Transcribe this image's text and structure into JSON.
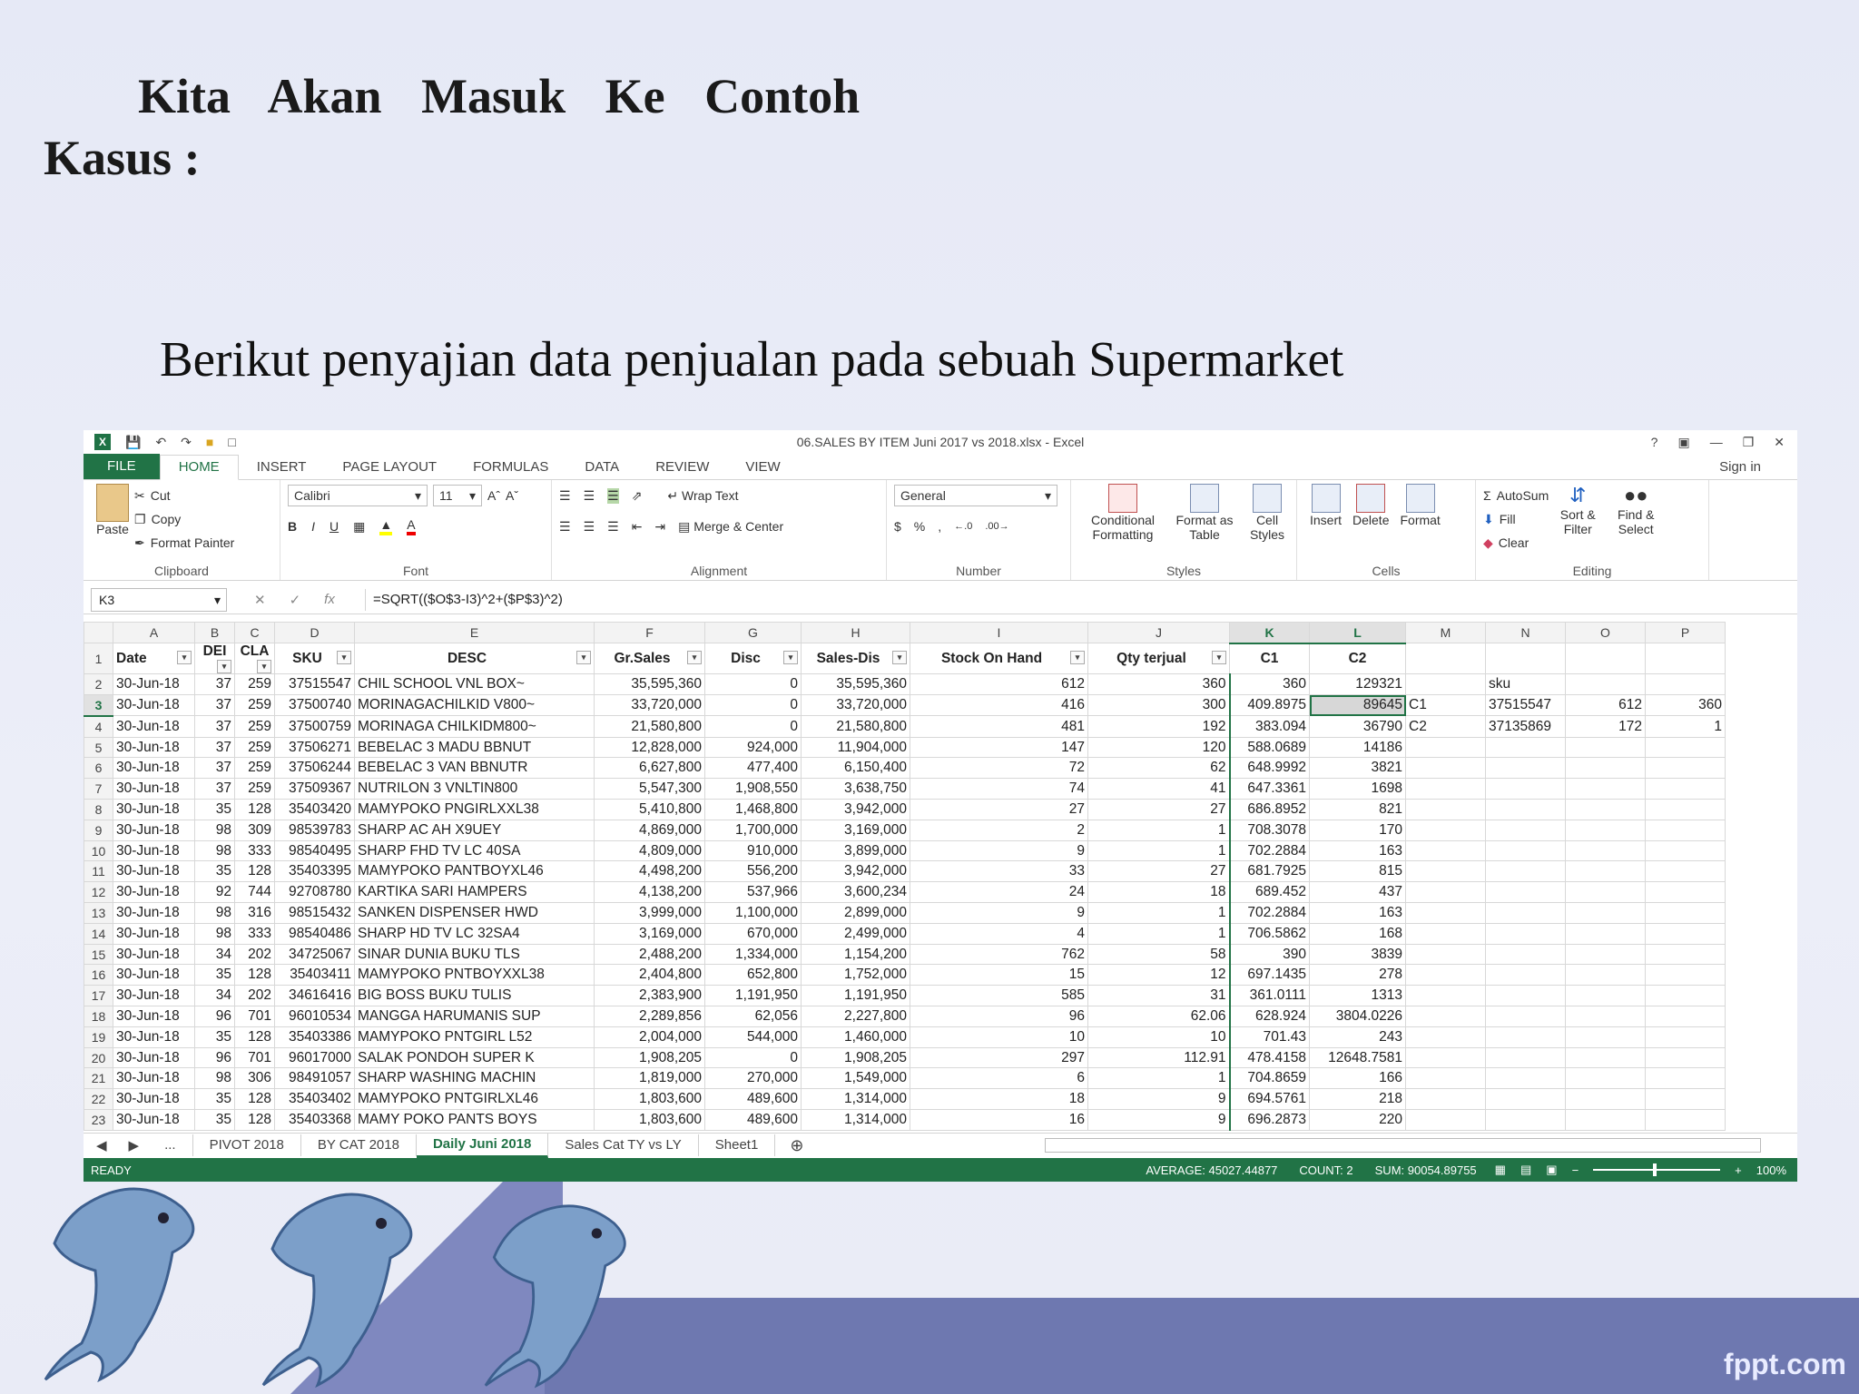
{
  "slide": {
    "title_line1": "Kita Akan Masuk Ke Contoh",
    "title_line2": "Kasus :",
    "subtitle": "Berikut penyajian data penjualan pada sebuah Supermarket",
    "watermark": "fppt.com"
  },
  "excel": {
    "window_title": "06.SALES BY ITEM Juni 2017 vs  2018.xlsx - Excel",
    "sign_in": "Sign in",
    "tabs": [
      "FILE",
      "HOME",
      "INSERT",
      "PAGE LAYOUT",
      "FORMULAS",
      "DATA",
      "REVIEW",
      "VIEW"
    ],
    "ribbon": {
      "clipboard": {
        "paste": "Paste",
        "cut": "Cut",
        "copy": "Copy",
        "format_painter": "Format Painter",
        "label": "Clipboard"
      },
      "font": {
        "name": "Calibri",
        "size": "11",
        "label": "Font"
      },
      "alignment": {
        "wrap": "Wrap Text",
        "merge": "Merge & Center",
        "label": "Alignment"
      },
      "number": {
        "format": "General",
        "label": "Number"
      },
      "styles": {
        "cond": "Conditional Formatting",
        "table": "Format as Table",
        "cell": "Cell Styles",
        "label": "Styles"
      },
      "cells": {
        "insert": "Insert",
        "delete": "Delete",
        "format": "Format",
        "label": "Cells"
      },
      "editing": {
        "autosum": "AutoSum",
        "fill": "Fill",
        "clear": "Clear",
        "sort": "Sort & Filter",
        "find": "Find & Select",
        "label": "Editing"
      }
    },
    "namebox": "K3",
    "formula": "=SQRT(($O$3-I3)^2+($P$3)^2)",
    "columns": [
      "A",
      "B",
      "C",
      "D",
      "E",
      "F",
      "G",
      "H",
      "I",
      "J",
      "K",
      "L",
      "M",
      "N",
      "O",
      "P"
    ],
    "header_row": [
      "Date",
      "DEI",
      "CLA",
      "SKU",
      "DESC",
      "Gr.Sales",
      "Disc",
      "Sales-Dis",
      "Stock On Hand",
      "Qty terjual",
      "C1",
      "C2"
    ],
    "rows": [
      [
        "30-Jun-18",
        "37",
        "259",
        "37515547",
        "CHIL SCHOOL VNL BOX~",
        "35,595,360",
        "0",
        "35,595,360",
        "612",
        "360",
        "360",
        "129321"
      ],
      [
        "30-Jun-18",
        "37",
        "259",
        "37500740",
        "MORINAGACHILKID V800~",
        "33,720,000",
        "0",
        "33,720,000",
        "416",
        "300",
        "409.8975",
        "89645"
      ],
      [
        "30-Jun-18",
        "37",
        "259",
        "37500759",
        "MORINAGA CHILKIDM800~",
        "21,580,800",
        "0",
        "21,580,800",
        "481",
        "192",
        "383.094",
        "36790"
      ],
      [
        "30-Jun-18",
        "37",
        "259",
        "37506271",
        "BEBELAC 3 MADU BBNUT",
        "12,828,000",
        "924,000",
        "11,904,000",
        "147",
        "120",
        "588.0689",
        "14186"
      ],
      [
        "30-Jun-18",
        "37",
        "259",
        "37506244",
        "BEBELAC 3 VAN BBNUTR",
        "6,627,800",
        "477,400",
        "6,150,400",
        "72",
        "62",
        "648.9992",
        "3821"
      ],
      [
        "30-Jun-18",
        "37",
        "259",
        "37509367",
        "NUTRILON 3 VNLTIN800",
        "5,547,300",
        "1,908,550",
        "3,638,750",
        "74",
        "41",
        "647.3361",
        "1698"
      ],
      [
        "30-Jun-18",
        "35",
        "128",
        "35403420",
        "MAMYPOKO PNGIRLXXL38",
        "5,410,800",
        "1,468,800",
        "3,942,000",
        "27",
        "27",
        "686.8952",
        "821"
      ],
      [
        "30-Jun-18",
        "98",
        "309",
        "98539783",
        "SHARP AC AH X9UEY",
        "4,869,000",
        "1,700,000",
        "3,169,000",
        "2",
        "1",
        "708.3078",
        "170"
      ],
      [
        "30-Jun-18",
        "98",
        "333",
        "98540495",
        "SHARP FHD TV LC 40SA",
        "4,809,000",
        "910,000",
        "3,899,000",
        "9",
        "1",
        "702.2884",
        "163"
      ],
      [
        "30-Jun-18",
        "35",
        "128",
        "35403395",
        "MAMYPOKO PANTBOYXL46",
        "4,498,200",
        "556,200",
        "3,942,000",
        "33",
        "27",
        "681.7925",
        "815"
      ],
      [
        "30-Jun-18",
        "92",
        "744",
        "92708780",
        "KARTIKA SARI HAMPERS",
        "4,138,200",
        "537,966",
        "3,600,234",
        "24",
        "18",
        "689.452",
        "437"
      ],
      [
        "30-Jun-18",
        "98",
        "316",
        "98515432",
        "SANKEN DISPENSER HWD",
        "3,999,000",
        "1,100,000",
        "2,899,000",
        "9",
        "1",
        "702.2884",
        "163"
      ],
      [
        "30-Jun-18",
        "98",
        "333",
        "98540486",
        "SHARP HD TV LC 32SA4",
        "3,169,000",
        "670,000",
        "2,499,000",
        "4",
        "1",
        "706.5862",
        "168"
      ],
      [
        "30-Jun-18",
        "34",
        "202",
        "34725067",
        "SINAR DUNIA BUKU TLS",
        "2,488,200",
        "1,334,000",
        "1,154,200",
        "762",
        "58",
        "390",
        "3839"
      ],
      [
        "30-Jun-18",
        "35",
        "128",
        "35403411",
        "MAMYPOKO PNTBOYXXL38",
        "2,404,800",
        "652,800",
        "1,752,000",
        "15",
        "12",
        "697.1435",
        "278"
      ],
      [
        "30-Jun-18",
        "34",
        "202",
        "34616416",
        "BIG BOSS BUKU TULIS",
        "2,383,900",
        "1,191,950",
        "1,191,950",
        "585",
        "31",
        "361.0111",
        "1313"
      ],
      [
        "30-Jun-18",
        "96",
        "701",
        "96010534",
        "MANGGA HARUMANIS SUP",
        "2,289,856",
        "62,056",
        "2,227,800",
        "96",
        "62.06",
        "628.924",
        "3804.0226"
      ],
      [
        "30-Jun-18",
        "35",
        "128",
        "35403386",
        "MAMYPOKO PNTGIRL L52",
        "2,004,000",
        "544,000",
        "1,460,000",
        "10",
        "10",
        "701.43",
        "243"
      ],
      [
        "30-Jun-18",
        "96",
        "701",
        "96017000",
        "SALAK PONDOH SUPER K",
        "1,908,205",
        "0",
        "1,908,205",
        "297",
        "112.91",
        "478.4158",
        "12648.7581"
      ],
      [
        "30-Jun-18",
        "98",
        "306",
        "98491057",
        "SHARP WASHING MACHIN",
        "1,819,000",
        "270,000",
        "1,549,000",
        "6",
        "1",
        "704.8659",
        "166"
      ],
      [
        "30-Jun-18",
        "35",
        "128",
        "35403402",
        "MAMYPOKO PNTGIRLXL46",
        "1,803,600",
        "489,600",
        "1,314,000",
        "18",
        "9",
        "694.5761",
        "218"
      ],
      [
        "30-Jun-18",
        "35",
        "128",
        "35403368",
        "MAMY POKO PANTS BOYS",
        "1,803,600",
        "489,600",
        "1,314,000",
        "16",
        "9",
        "696.2873",
        "220"
      ]
    ],
    "side_table": {
      "label": "sku",
      "r1": [
        "C1",
        "37515547",
        "612",
        "360"
      ],
      "r2": [
        "C2",
        "37135869",
        "172",
        "1"
      ]
    },
    "sheet_tabs": [
      "...",
      "PIVOT 2018",
      "BY CAT 2018",
      "Daily Juni 2018",
      "Sales Cat TY vs LY",
      "Sheet1"
    ],
    "status": {
      "ready": "READY",
      "average": "AVERAGE: 45027.44877",
      "count": "COUNT: 2",
      "sum": "SUM: 90054.89755",
      "zoom": "100%"
    }
  }
}
